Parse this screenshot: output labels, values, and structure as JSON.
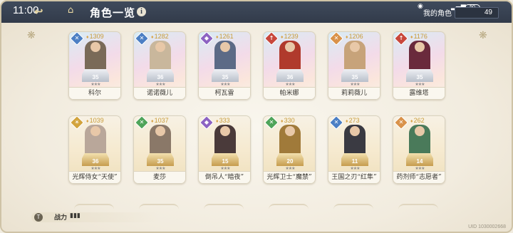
{
  "status_bar": {
    "time": "11:00",
    "battery": "50"
  },
  "header": {
    "title": "角色一览",
    "info": "i",
    "my_characters_label": "我的角色",
    "owned_count": "49"
  },
  "characters": [
    {
      "name": "科尔",
      "power": "1309",
      "level": "35",
      "element": "blue",
      "element_glyph": "✕",
      "sprite_color": "#7a6a58"
    },
    {
      "name": "诺诺薇儿",
      "power": "1282",
      "level": "36",
      "element": "blue",
      "element_glyph": "✕",
      "sprite_color": "#c9b79c"
    },
    {
      "name": "柯瓦雷",
      "power": "1261",
      "level": "35",
      "element": "purple",
      "element_glyph": "◆",
      "sprite_color": "#5c6a86"
    },
    {
      "name": "帕米娜",
      "power": "1239",
      "level": "36",
      "element": "red",
      "element_glyph": "↑",
      "sprite_color": "#b03a2c"
    },
    {
      "name": "莉莉薇儿",
      "power": "1206",
      "level": "35",
      "element": "orange",
      "element_glyph": "✕",
      "sprite_color": "#c7a37a"
    },
    {
      "name": "露维塔",
      "power": "1176",
      "level": "35",
      "element": "red",
      "element_glyph": "↑",
      "sprite_color": "#6a2a3c"
    },
    {
      "name": "光辉侍女“天使”",
      "power": "1039",
      "level": "36",
      "element": "gold",
      "element_glyph": "☀",
      "sprite_color": "#b9a79a"
    },
    {
      "name": "麦莎",
      "power": "1037",
      "level": "35",
      "element": "green",
      "element_glyph": "✕",
      "sprite_color": "#8a7868"
    },
    {
      "name": "倒吊人“暗夜”",
      "power": "333",
      "level": "15",
      "element": "purple",
      "element_glyph": "◆",
      "sprite_color": "#4a3a3a"
    },
    {
      "name": "光辉卫士“魔禁”",
      "power": "330",
      "level": "20",
      "element": "green",
      "element_glyph": "✕",
      "sprite_color": "#a07a3a"
    },
    {
      "name": "王国之刃“红隼”",
      "power": "273",
      "level": "11",
      "element": "blue",
      "element_glyph": "✕",
      "sprite_color": "#3a3a42"
    },
    {
      "name": "药剂师“志愿者”",
      "power": "262",
      "level": "14",
      "element": "orange",
      "element_glyph": "✕",
      "sprite_color": "#4a7a5a"
    }
  ],
  "footer": {
    "filter_badge": "T",
    "sort_label": "战力",
    "sort_icon": "▮▮▮",
    "uid": "UID 1030002668"
  },
  "icons": {
    "back": "back-arrow-icon",
    "home": "home-icon",
    "info": "info-icon",
    "sort": "sort-bars-icon"
  }
}
